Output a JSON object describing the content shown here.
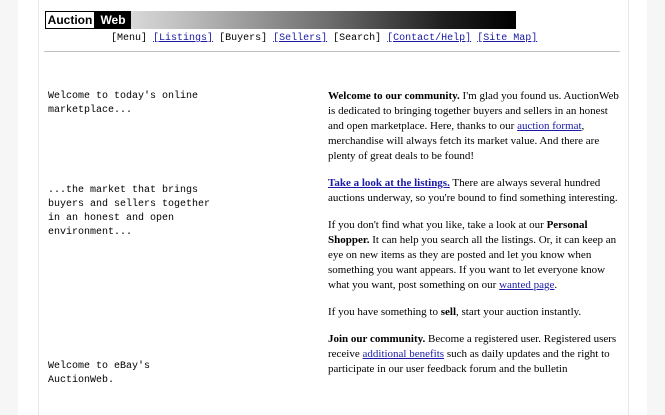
{
  "logo": {
    "part1": "Auction",
    "part2": "Web"
  },
  "nav": {
    "menu": "[Menu]",
    "listings": "[Listings]",
    "buyers": "[Buyers]",
    "sellers": "[Sellers]",
    "search": "[Search]",
    "contact": "[Contact/Help]",
    "sitemap": "[Site Map]"
  },
  "left": {
    "welcome": "Welcome to today's online\nmarketplace...",
    "market": "...the market that brings\nbuyers and sellers together\nin an honest and open\nenvironment...",
    "ebay": "Welcome to eBay's\nAuctionWeb."
  },
  "right": {
    "p1_bold": "Welcome to our community.",
    "p1_text1": " I'm glad you found us. AuctionWeb is dedicated to bringing together buyers and sellers in an honest and open marketplace. Here, thanks to our ",
    "p1_link": "auction format",
    "p1_text2": ", merchandise will always fetch its market value. And there are plenty of great deals to be found!",
    "p2_link": "Take a look at the listings.",
    "p2_text": " There are always several hundred auctions underway, so you're bound to find something interesting.",
    "p3_text1": "If you don't find what you like, take a look at our ",
    "p3_bold": "Personal Shopper.",
    "p3_text2": " It can help you search all the listings. Or, it can keep an eye on new items as they are posted and let you know when something you want appears. If you want to let everyone know what you want, post something on our ",
    "p3_link": "wanted page",
    "p3_text3": ".",
    "p4_text1": "If you have something to ",
    "p4_bold": "sell",
    "p4_text2": ", start your auction instantly.",
    "p5_bold": "Join our community.",
    "p5_text1": " Become a registered user. Registered users receive ",
    "p5_link": "additional benefits",
    "p5_text2": " such as daily updates and the right to participate in our user feedback forum and the bulletin"
  }
}
